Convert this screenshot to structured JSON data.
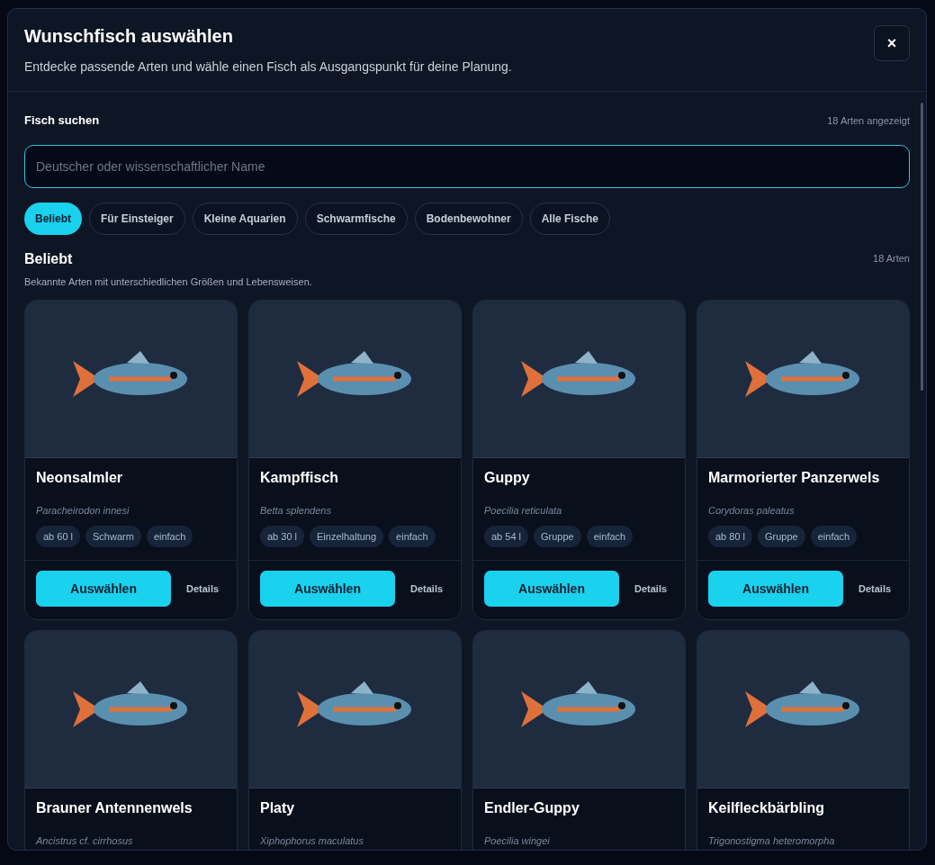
{
  "dialog": {
    "title": "Wunschfisch auswählen",
    "subtitle": "Entdecke passende Arten und wähle einen Fisch als Ausgangspunkt für deine Planung.",
    "close": "×"
  },
  "search": {
    "label": "Fisch suchen",
    "count": "18 Arten angezeigt",
    "placeholder": "Deutscher oder wissenschaftlicher Name"
  },
  "filters": [
    {
      "label": "Beliebt",
      "selected": true
    },
    {
      "label": "Für Einsteiger",
      "selected": false
    },
    {
      "label": "Kleine Aquarien",
      "selected": false
    },
    {
      "label": "Schwarmfische",
      "selected": false
    },
    {
      "label": "Bodenbewohner",
      "selected": false
    },
    {
      "label": "Alle Fische",
      "selected": false
    }
  ],
  "section": {
    "title": "Beliebt",
    "count": "18 Arten",
    "description": "Bekannte Arten mit unterschiedlichen Größen und Lebensweisen."
  },
  "cards": [
    {
      "name": "Neonsalmler",
      "latin": "Paracheirodon innesi",
      "tags": [
        "ab 60 l",
        "Schwarm",
        "einfach"
      ],
      "select": "Auswählen",
      "details": "Details"
    },
    {
      "name": "Kampffisch",
      "latin": "Betta splendens",
      "tags": [
        "ab 30 l",
        "Einzelhaltung",
        "einfach"
      ],
      "select": "Auswählen",
      "details": "Details"
    },
    {
      "name": "Guppy",
      "latin": "Poecilia reticulata",
      "tags": [
        "ab 54 l",
        "Gruppe",
        "einfach"
      ],
      "select": "Auswählen",
      "details": "Details"
    },
    {
      "name": "Marmorierter Panzerwels",
      "latin": "Corydoras paleatus",
      "tags": [
        "ab 80 l",
        "Gruppe",
        "einfach"
      ],
      "select": "Auswählen",
      "details": "Details"
    },
    {
      "name": "Brauner Antennenwels",
      "latin": "Ancistrus cf. cirrhosus"
    },
    {
      "name": "Platy",
      "latin": "Xiphophorus maculatus"
    },
    {
      "name": "Endler-Guppy",
      "latin": "Poecilia wingei"
    },
    {
      "name": "Keilfleckbärbling",
      "latin": "Trigonostigma heteromorpha"
    }
  ]
}
